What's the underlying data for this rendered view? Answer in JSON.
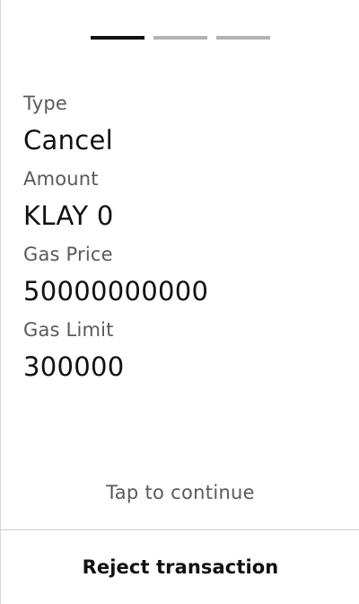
{
  "progress": {
    "steps_total": 3,
    "active_step": 1
  },
  "fields": [
    {
      "label": "Type",
      "value": "Cancel"
    },
    {
      "label": "Amount",
      "value": "KLAY 0"
    },
    {
      "label": "Gas Price",
      "value": "50000000000"
    },
    {
      "label": "Gas Limit",
      "value": "300000"
    }
  ],
  "hint": "Tap to continue",
  "reject_label": "Reject transaction",
  "colors": {
    "progress_active": "#111111",
    "progress_inactive": "#b3b3b3",
    "label_text": "#5a5a5a",
    "value_text": "#111111"
  }
}
